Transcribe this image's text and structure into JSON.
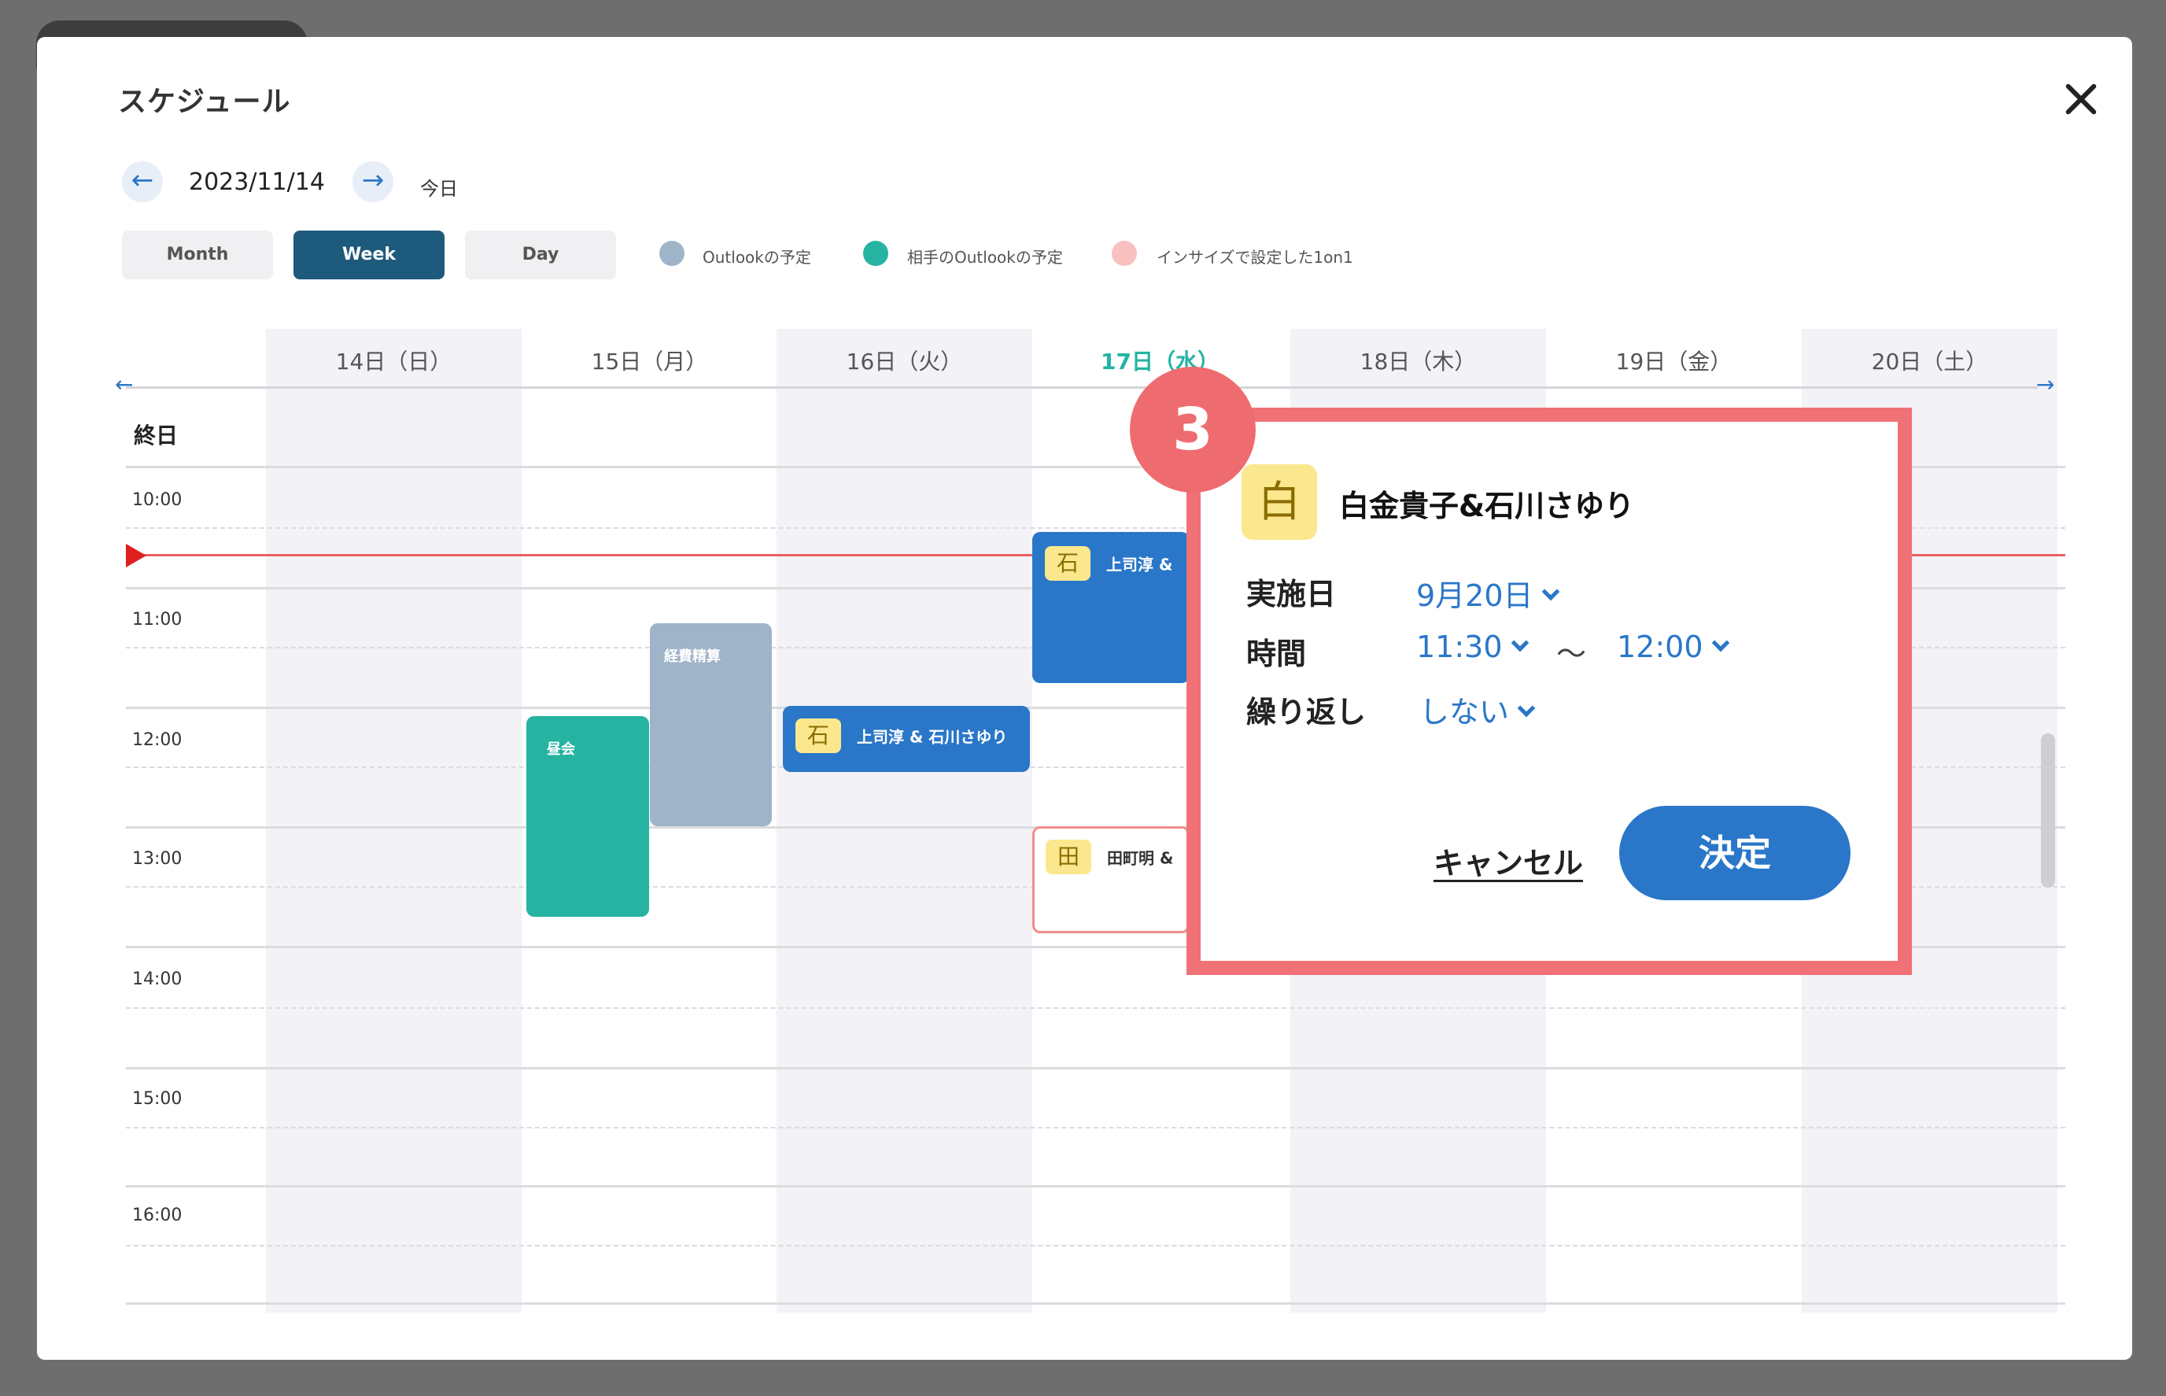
{
  "modal": {
    "title": "スケジュール"
  },
  "nav": {
    "date": "2023/11/14",
    "today": "今日",
    "prev_icon": "arrow-left-icon",
    "next_icon": "arrow-right-icon"
  },
  "views": [
    {
      "label": "Month",
      "active": false
    },
    {
      "label": "Week",
      "active": true
    },
    {
      "label": "Day",
      "active": false
    }
  ],
  "legend": [
    {
      "label": "Outlookの予定",
      "color": "#9fb4c8"
    },
    {
      "label": "相手のOutlookの予定",
      "color": "#26b3a2"
    },
    {
      "label": "インサイズで設定した1on1",
      "color": "#f9c0c0"
    }
  ],
  "days": [
    "14日（日）",
    "15日（月）",
    "16日（火）",
    "17日（水）",
    "18日（木）",
    "19日（金）",
    "20日（土）"
  ],
  "allday_label": "終日",
  "times": [
    "10:00",
    "11:00",
    "12:00",
    "13:00",
    "14:00",
    "15:00",
    "16:00"
  ],
  "events": [
    {
      "label": "経費精算",
      "color": "#9fb4c8"
    },
    {
      "label": "昼会",
      "color": "#26b3a2"
    },
    {
      "badge": "石",
      "label": "上司淳 & 石川さゆり"
    },
    {
      "badge": "石",
      "label": "上司淳 &"
    },
    {
      "badge": "田",
      "label": "田町明 &"
    }
  ],
  "popup": {
    "step": "3",
    "avatar": "白",
    "name": "白金貴子&石川さゆり",
    "date_label": "実施日",
    "date_value": "9月20日",
    "time_label": "時間",
    "time_start": "11:30",
    "time_sep": "〜",
    "time_end": "12:00",
    "repeat_label": "繰り返し",
    "repeat_value": "しない",
    "cancel_label": "キャンセル",
    "ok_label": "決定"
  },
  "colors": {
    "accent": "#2a77c9",
    "highlight": "#f07276",
    "active_view": "#1e5a7c",
    "today": "#26b3a2"
  }
}
